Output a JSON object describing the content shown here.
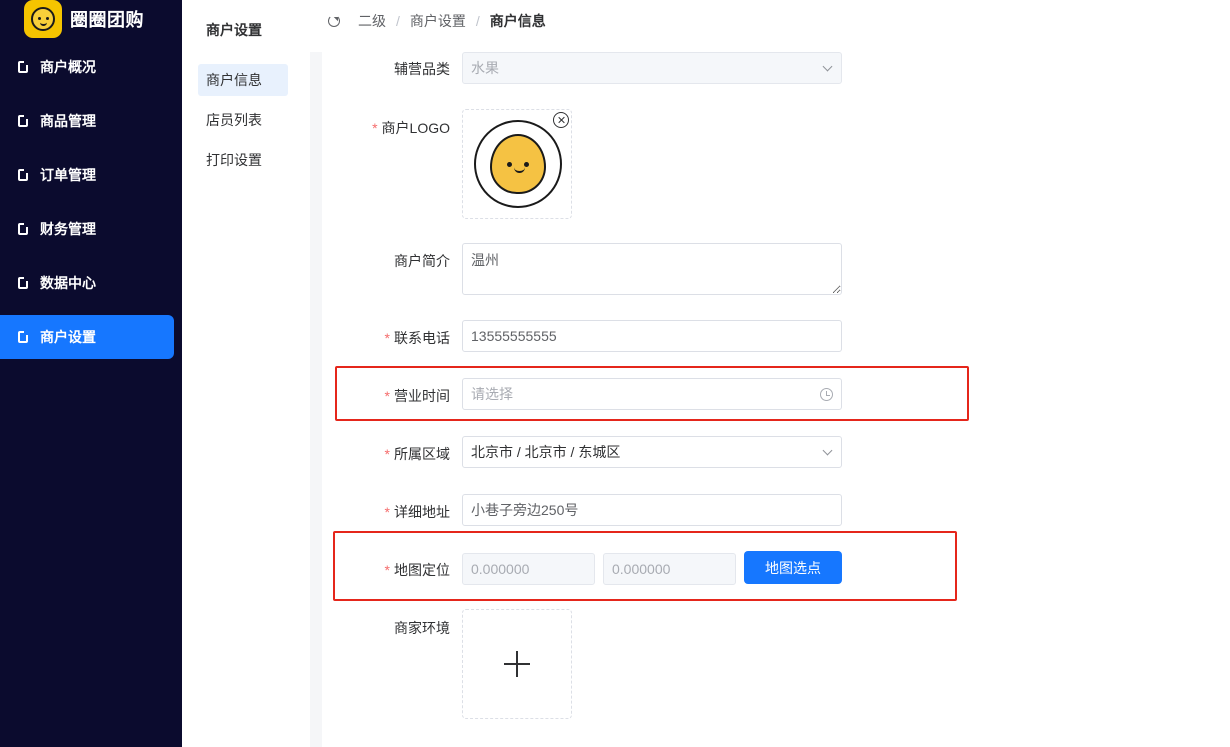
{
  "brand": {
    "name": "圈圈团购",
    "logo_icon": "smiley-logo-icon"
  },
  "sidebar": {
    "items": [
      {
        "label": "商户概况",
        "icon": "file-icon",
        "active": false
      },
      {
        "label": "商品管理",
        "icon": "file-icon",
        "active": false
      },
      {
        "label": "订单管理",
        "icon": "file-icon",
        "active": false
      },
      {
        "label": "财务管理",
        "icon": "file-icon",
        "active": false
      },
      {
        "label": "数据中心",
        "icon": "file-icon",
        "active": false
      },
      {
        "label": "商户设置",
        "icon": "file-icon",
        "active": true
      }
    ],
    "active_color": "#1677ff",
    "background": "#0b0b2e"
  },
  "submenu": {
    "title": "商户设置",
    "items": [
      {
        "label": "商户信息",
        "active": true
      },
      {
        "label": "店员列表",
        "active": false
      },
      {
        "label": "打印设置",
        "active": false
      }
    ]
  },
  "breadcrumb": {
    "refresh_icon": "refresh-icon",
    "items": [
      "二级",
      "商户设置",
      "商户信息"
    ],
    "separator": "/"
  },
  "form": {
    "sub_category": {
      "label": "辅营品类",
      "value": "水果",
      "required": false,
      "disabled": true
    },
    "logo": {
      "label": "商户LOGO",
      "required": true
    },
    "intro": {
      "label": "商户简介",
      "value": "温州",
      "required": false
    },
    "phone": {
      "label": "联系电话",
      "value": "13555555555",
      "required": true
    },
    "hours": {
      "label": "营业时间",
      "placeholder": "请选择",
      "required": true
    },
    "region": {
      "label": "所属区域",
      "value": "北京市 / 北京市 / 东城区",
      "required": true
    },
    "address": {
      "label": "详细地址",
      "value": "小巷子旁边250号",
      "required": true
    },
    "location": {
      "label": "地图定位",
      "longitude": "0.000000",
      "latitude": "0.000000",
      "button": "地图选点",
      "required": true
    },
    "environment": {
      "label": "商家环境",
      "required": false
    },
    "required_mark": "*"
  },
  "colors": {
    "primary": "#1677ff",
    "required": "#f56c6c",
    "highlight": "#e5261b"
  }
}
